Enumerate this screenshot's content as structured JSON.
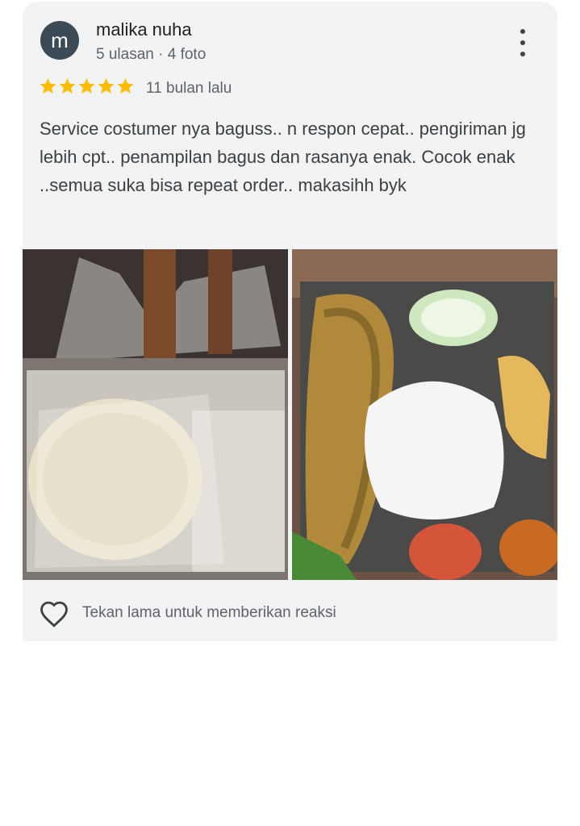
{
  "review": {
    "avatar_letter": "m",
    "author": "malika nuha",
    "meta": "5 ulasan · 4 foto",
    "rating": 5,
    "date": "11 bulan lalu",
    "text": "Service costumer nya baguss.. n respon cepat.. pengiriman jg lebih cpt.. penampilan bagus dan rasanya enak. Cocok enak ..semua suka bisa repeat order.. makasihh byk",
    "reaction_hint": "Tekan lama untuk memberikan reaksi"
  },
  "colors": {
    "card_bg": "#f1f3f4",
    "avatar_bg": "#3c4a55",
    "star": "#fbbc04",
    "text_primary": "#202124",
    "text_secondary": "#5f6368"
  },
  "icons": {
    "menu": "more-vert-icon",
    "star": "star-icon",
    "reaction": "heart-outline-icon"
  }
}
